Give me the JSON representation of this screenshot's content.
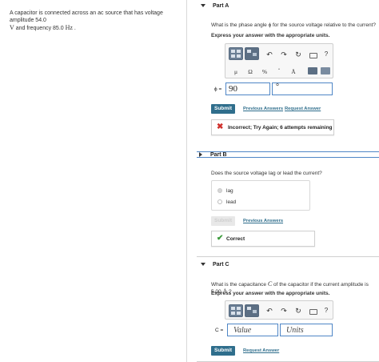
{
  "problem": {
    "line1": "A capacitor is connected across an ac source that has voltage amplitude 54.0",
    "line2_v": "V",
    "line2_mid": " and frequency 85.0 ",
    "line2_unit": "Hz",
    "line2_end": " ."
  },
  "partA": {
    "title": "Part A",
    "question": "What is the phase angle ϕ for the source voltage relative to the current?",
    "instruction": "Express your answer with the appropriate units.",
    "toolbar": {
      "mu": "μ",
      "omega": "Ω",
      "percent": "%",
      "dot": "•",
      "angstrom": "Å",
      "help": "?"
    },
    "label": "ϕ =",
    "value": "90",
    "unit_value": "°",
    "submit": "Submit",
    "previous_answers": "Previous Answers",
    "request_answer": "Request Answer",
    "feedback": "Incorrect; Try Again; 6 attempts remaining",
    "feedback_icon": "x-icon",
    "colors": {
      "incorrect": "#d0312d",
      "correct": "#3a9a3a",
      "accent": "#2f6e8c"
    }
  },
  "partB": {
    "title": "Part B",
    "question": "Does the source voltage lag or lead the current?",
    "options": [
      "lag",
      "lead"
    ],
    "selected": "lag",
    "submit": "Submit",
    "previous_answers": "Previous Answers",
    "feedback": "Correct"
  },
  "partC": {
    "title": "Part C",
    "question_pre": "What is the capacitance ",
    "question_var": "C",
    "question_post": " of the capacitor if the current amplitude is 5.00 ",
    "question_unit": "A",
    "question_end": " ?",
    "instruction": "Express your answer with the appropriate units.",
    "help": "?",
    "label": "C =",
    "value_placeholder": "Value",
    "units_placeholder": "Units",
    "submit": "Submit",
    "request_answer": "Request Answer"
  }
}
